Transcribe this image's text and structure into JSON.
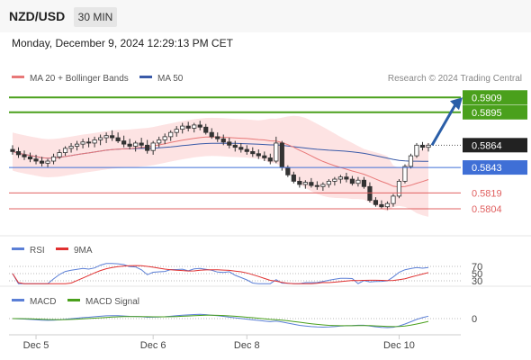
{
  "header": {
    "symbol": "NZD/USD",
    "timeframe": "30 MIN"
  },
  "datetime": "Monday, December 9, 2024 12:29:13 PM CET",
  "legend": {
    "ma20": "MA 20 + Bollinger Bands",
    "ma50": "MA 50",
    "credit": "Research © 2024 Trading Central"
  },
  "rsi_legend": {
    "rsi": "RSI",
    "ma": "9MA"
  },
  "macd_legend": {
    "macd": "MACD",
    "signal": "MACD Signal"
  },
  "colors": {
    "candle": "#333333",
    "ma20": "#e87878",
    "ma50": "#3a5aa8",
    "band_fill": "#fde3e3",
    "green_level": "#4aa01c",
    "blue_level": "#3f6fd6",
    "red_level": "#e06060",
    "arrow": "#2a5ea8",
    "rsi": "#5b7fd6",
    "rsi_ma": "#e03030",
    "macd": "#5b7fd6",
    "macd_signal": "#4aa01c"
  },
  "chart_data": {
    "type": "candlestick",
    "title": "NZD/USD",
    "x_ticks": [
      "Dec 5",
      "Dec 6",
      "Dec 8",
      "Dec 10"
    ],
    "ylim": [
      0.5782,
      0.5916
    ],
    "levels": [
      {
        "value": "0.5909",
        "kind": "resistance",
        "color": "green"
      },
      {
        "value": "0.5895",
        "kind": "resistance",
        "color": "green"
      },
      {
        "value": "0.5864",
        "kind": "last_price",
        "color": "black"
      },
      {
        "value": "0.5843",
        "kind": "pivot",
        "color": "blue"
      },
      {
        "value": "0.5819",
        "kind": "support",
        "color": "red"
      },
      {
        "value": "0.5804",
        "kind": "support",
        "color": "red"
      }
    ],
    "candles": [
      [
        0.586,
        0.5864,
        0.5855,
        0.5858
      ],
      [
        0.5858,
        0.5862,
        0.5852,
        0.5855
      ],
      [
        0.5855,
        0.5859,
        0.585,
        0.5853
      ],
      [
        0.5853,
        0.5857,
        0.5848,
        0.5851
      ],
      [
        0.5851,
        0.5855,
        0.5846,
        0.5849
      ],
      [
        0.5849,
        0.5853,
        0.5844,
        0.5847
      ],
      [
        0.5847,
        0.5851,
        0.5843,
        0.5849
      ],
      [
        0.5849,
        0.5856,
        0.5846,
        0.5853
      ],
      [
        0.5853,
        0.586,
        0.5851,
        0.5857
      ],
      [
        0.5857,
        0.5863,
        0.5854,
        0.5861
      ],
      [
        0.5861,
        0.5866,
        0.5857,
        0.5863
      ],
      [
        0.5863,
        0.5868,
        0.5859,
        0.5865
      ],
      [
        0.5865,
        0.587,
        0.5861,
        0.5867
      ],
      [
        0.5867,
        0.5871,
        0.5862,
        0.5866
      ],
      [
        0.5866,
        0.5872,
        0.5862,
        0.5869
      ],
      [
        0.5869,
        0.5874,
        0.5864,
        0.5871
      ],
      [
        0.5871,
        0.5876,
        0.5866,
        0.5873
      ],
      [
        0.5873,
        0.5878,
        0.5868,
        0.5871
      ],
      [
        0.5871,
        0.5876,
        0.5866,
        0.5868
      ],
      [
        0.5868,
        0.5873,
        0.5862,
        0.5865
      ],
      [
        0.5865,
        0.587,
        0.586,
        0.5863
      ],
      [
        0.5863,
        0.5868,
        0.5858,
        0.5866
      ],
      [
        0.5866,
        0.5871,
        0.5861,
        0.5864
      ],
      [
        0.5864,
        0.5869,
        0.5856,
        0.5859
      ],
      [
        0.5859,
        0.5868,
        0.5855,
        0.5866
      ],
      [
        0.5866,
        0.5872,
        0.5862,
        0.5869
      ],
      [
        0.5869,
        0.5875,
        0.5865,
        0.5872
      ],
      [
        0.5872,
        0.5878,
        0.5868,
        0.5876
      ],
      [
        0.5876,
        0.5882,
        0.5872,
        0.5879
      ],
      [
        0.5879,
        0.5885,
        0.5875,
        0.5882
      ],
      [
        0.5882,
        0.5886,
        0.5877,
        0.588
      ],
      [
        0.588,
        0.5885,
        0.5876,
        0.5883
      ],
      [
        0.5883,
        0.5887,
        0.5878,
        0.5881
      ],
      [
        0.5881,
        0.5884,
        0.5874,
        0.5876
      ],
      [
        0.5876,
        0.588,
        0.587,
        0.5872
      ],
      [
        0.5872,
        0.5876,
        0.5867,
        0.587
      ],
      [
        0.587,
        0.5874,
        0.5864,
        0.5867
      ],
      [
        0.5867,
        0.5871,
        0.5861,
        0.5864
      ],
      [
        0.5864,
        0.5868,
        0.5858,
        0.5862
      ],
      [
        0.5862,
        0.5866,
        0.5857,
        0.586
      ],
      [
        0.586,
        0.5864,
        0.5855,
        0.5858
      ],
      [
        0.5858,
        0.5862,
        0.5853,
        0.5856
      ],
      [
        0.5856,
        0.586,
        0.5851,
        0.5854
      ],
      [
        0.5854,
        0.5858,
        0.5849,
        0.5852
      ],
      [
        0.5852,
        0.5856,
        0.5846,
        0.5849
      ],
      [
        0.5849,
        0.5872,
        0.5847,
        0.5866
      ],
      [
        0.5866,
        0.5868,
        0.584,
        0.5843
      ],
      [
        0.5843,
        0.5845,
        0.5834,
        0.5836
      ],
      [
        0.5836,
        0.5839,
        0.5828,
        0.583
      ],
      [
        0.583,
        0.5834,
        0.5824,
        0.5827
      ],
      [
        0.5827,
        0.5831,
        0.5823,
        0.5829
      ],
      [
        0.5829,
        0.5833,
        0.5824,
        0.5826
      ],
      [
        0.5826,
        0.583,
        0.5822,
        0.5825
      ],
      [
        0.5825,
        0.5829,
        0.5821,
        0.5827
      ],
      [
        0.5827,
        0.5832,
        0.5824,
        0.583
      ],
      [
        0.583,
        0.5834,
        0.5826,
        0.5832
      ],
      [
        0.5832,
        0.5836,
        0.5828,
        0.5834
      ],
      [
        0.5834,
        0.5838,
        0.5829,
        0.5832
      ],
      [
        0.5832,
        0.5835,
        0.5826,
        0.5828
      ],
      [
        0.5828,
        0.5834,
        0.5825,
        0.5831
      ],
      [
        0.5831,
        0.5834,
        0.5823,
        0.5825
      ],
      [
        0.5825,
        0.5829,
        0.581,
        0.5812
      ],
      [
        0.5812,
        0.5815,
        0.5806,
        0.5808
      ],
      [
        0.5808,
        0.5812,
        0.5804,
        0.5806
      ],
      [
        0.5806,
        0.5811,
        0.5803,
        0.5809
      ],
      [
        0.5809,
        0.5818,
        0.5806,
        0.5816
      ],
      [
        0.5816,
        0.5832,
        0.5814,
        0.583
      ],
      [
        0.583,
        0.5846,
        0.5828,
        0.5844
      ],
      [
        0.5844,
        0.5856,
        0.5842,
        0.5854
      ],
      [
        0.5854,
        0.5866,
        0.5852,
        0.5864
      ],
      [
        0.5864,
        0.5867,
        0.5859,
        0.5862
      ],
      [
        0.5862,
        0.5866,
        0.5858,
        0.5864
      ]
    ],
    "indicators": {
      "rsi": {
        "levels": [
          "70",
          "50",
          "30"
        ]
      },
      "macd": {
        "levels": [
          "0"
        ]
      }
    }
  }
}
